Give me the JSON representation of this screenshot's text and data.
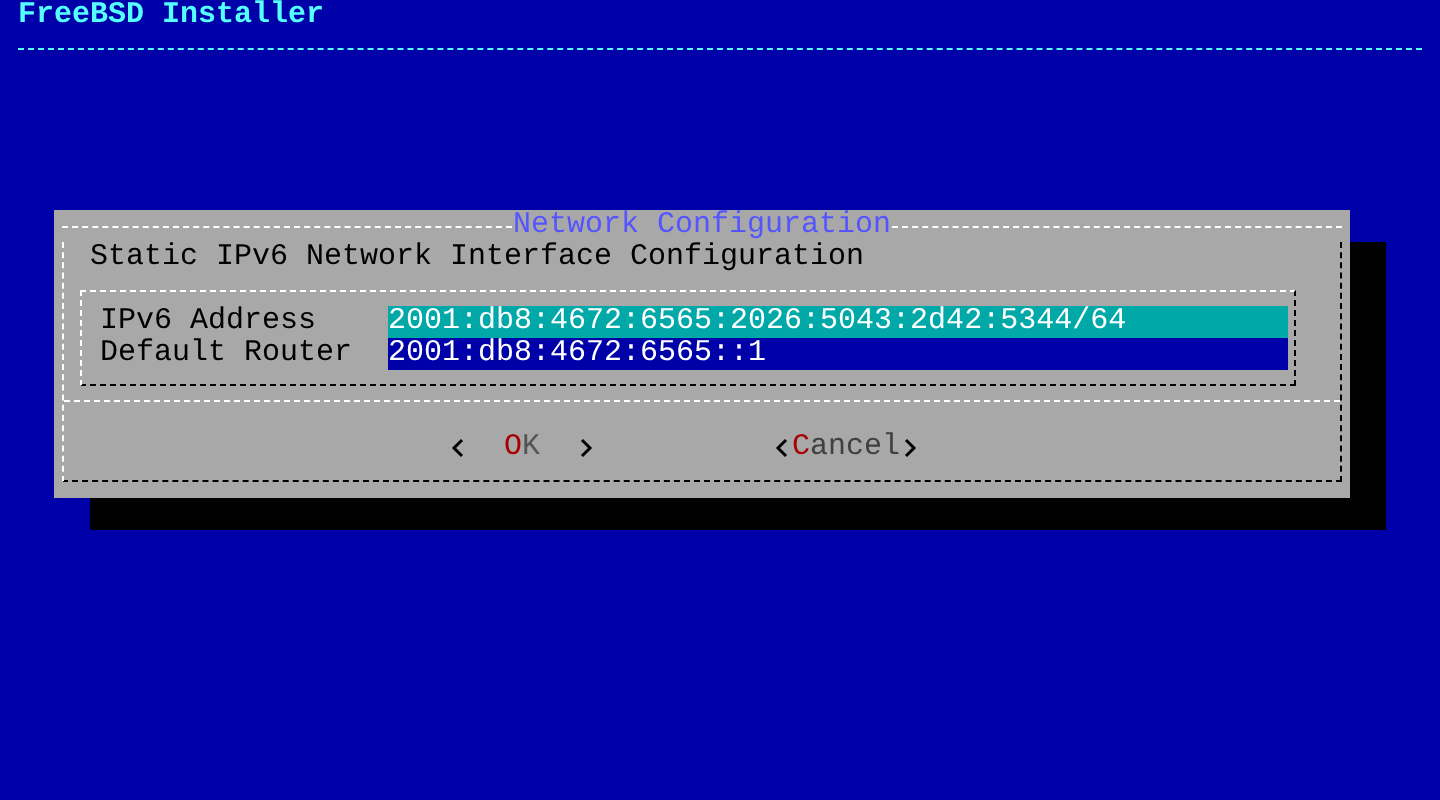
{
  "header": {
    "title": "FreeBSD Installer"
  },
  "dialog": {
    "title": "Network Configuration",
    "subtitle": "Static IPv6 Network Interface Configuration",
    "fields": [
      {
        "label": "IPv6 Address",
        "value": "2001:db8:4672:6565:2026:5043:2d42:5344/64",
        "selected": true
      },
      {
        "label": "Default Router",
        "value": "2001:db8:4672:6565::1",
        "selected": false
      }
    ],
    "buttons": [
      {
        "label": "OK",
        "selected": true
      },
      {
        "label": "Cancel",
        "selected": false
      }
    ]
  }
}
